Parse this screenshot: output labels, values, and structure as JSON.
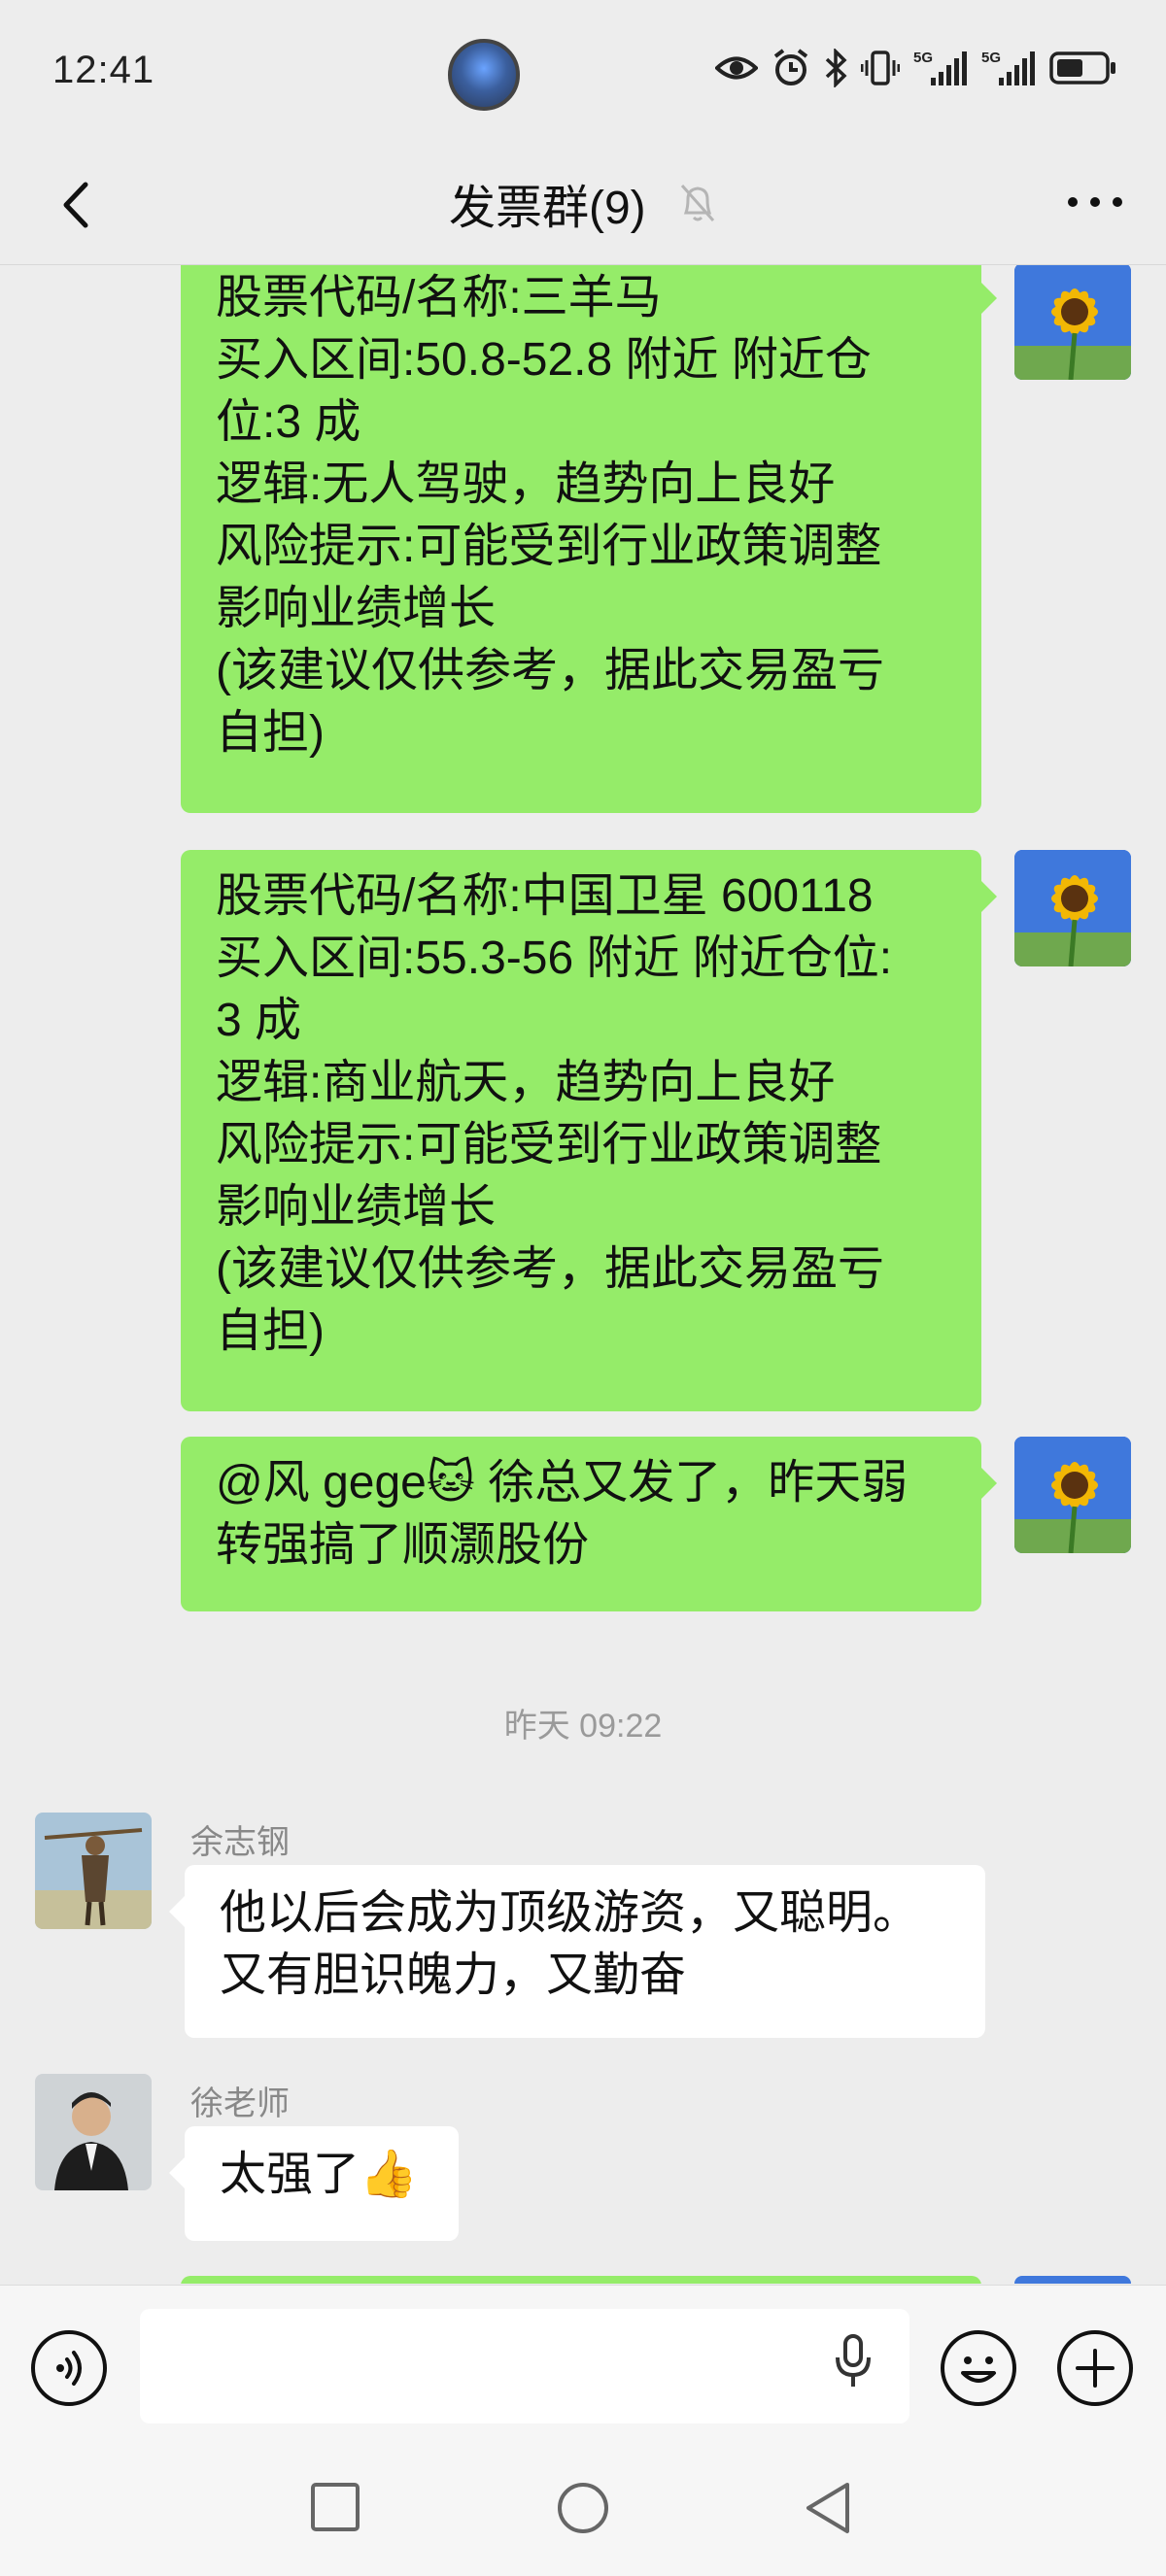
{
  "status_bar": {
    "time": "12:41",
    "icons": [
      "eye-icon",
      "alarm-icon",
      "bluetooth-icon",
      "vibrate-icon",
      "signal-5g-icon",
      "signal-5g-icon",
      "battery-icon"
    ],
    "signal_label_1": "5G",
    "signal_label_2": "5G"
  },
  "header": {
    "title": "发票群(9)",
    "muted": true
  },
  "messages": [
    {
      "from": "me",
      "lines": [
        "股票代码/名称:三羊马",
        "买入区间:50.8-52.8 附近  附近仓",
        "位:3 成",
        "逻辑:无人驾驶，趋势向上良好",
        "风险提示:可能受到行业政策调整",
        "影响业绩增长",
        "(该建议仅供参考，据此交易盈亏",
        "自担)"
      ]
    },
    {
      "from": "me",
      "lines": [
        "股票代码/名称:中国卫星 600118",
        "买入区间:55.3-56 附近  附近仓位:",
        "3 成",
        "逻辑:商业航天，趋势向上良好",
        "风险提示:可能受到行业政策调整",
        "影响业绩增长",
        "(该建议仅供参考，据此交易盈亏",
        "自担)"
      ]
    },
    {
      "from": "me",
      "mention": "@风 gege",
      "emoji": "🐱",
      "line1_rest": " 徐总又发了，昨天弱",
      "line2": "转强搞了顺灏股份"
    }
  ],
  "timestamp": "昨天 09:22",
  "others": [
    {
      "sender": "余志钢",
      "lines": [
        "他以后会成为顶级游资，又聪明。",
        "又有胆识魄力，又勤奋"
      ]
    },
    {
      "sender": "徐老师",
      "text": "太强了",
      "emoji": "👍"
    }
  ],
  "input": {
    "value": "",
    "placeholder": ""
  },
  "colors": {
    "my_bubble": "#95ec69",
    "other_bubble": "#ffffff",
    "background": "#ededed"
  }
}
